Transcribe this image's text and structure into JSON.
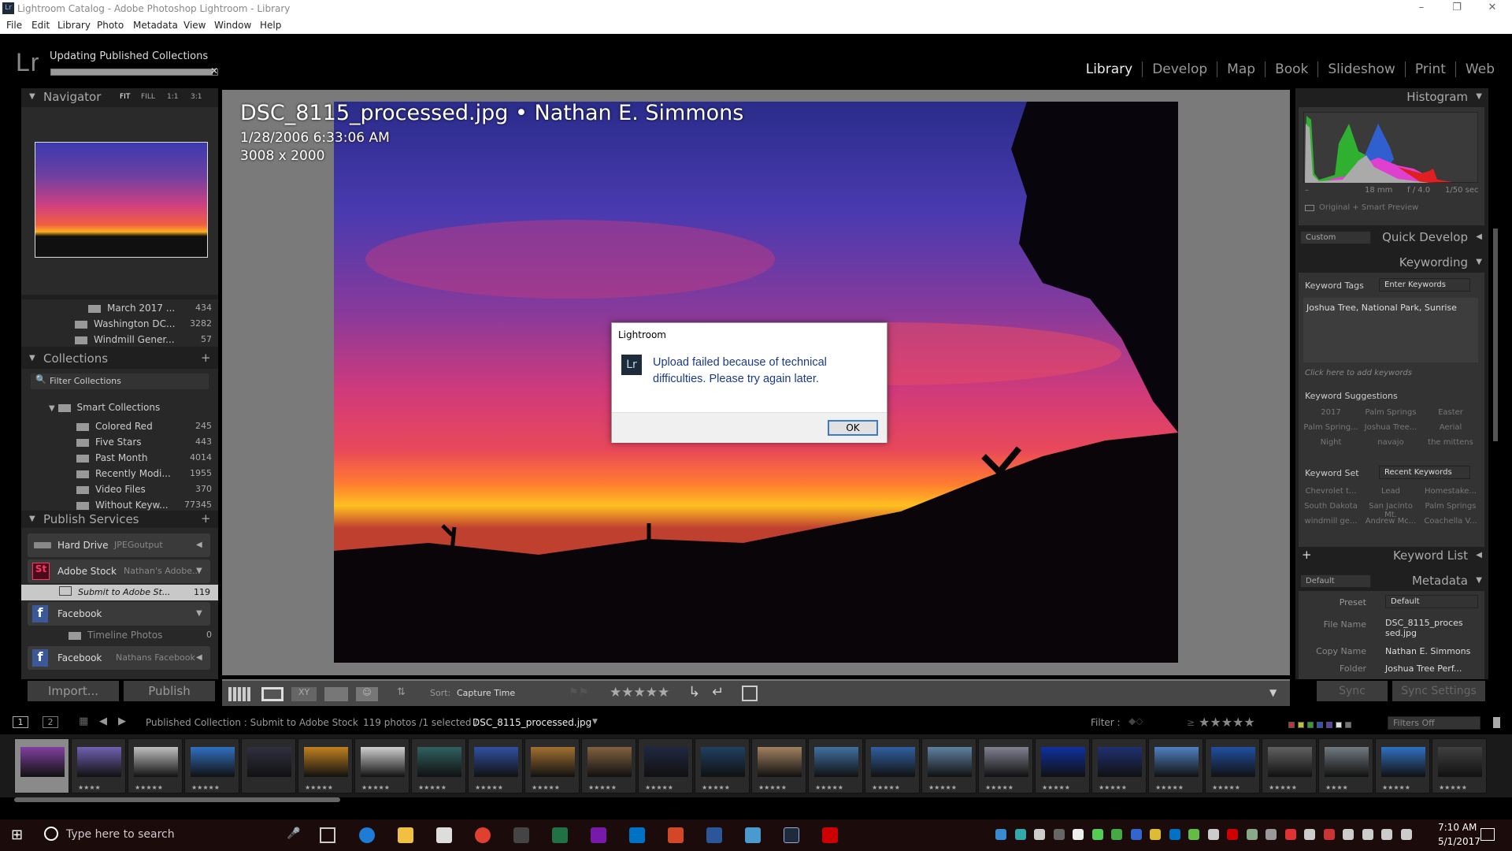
{
  "window": {
    "title": "Lightroom Catalog - Adobe Photoshop Lightroom - Library",
    "minimize": "–",
    "restore": "❐",
    "close": "✕",
    "icon": "Lr"
  },
  "menu": [
    "File",
    "Edit",
    "Library",
    "Photo",
    "Metadata",
    "View",
    "Window",
    "Help"
  ],
  "header": {
    "logo": "Lr",
    "status": "Updating Published Collections",
    "progress": 0.97,
    "cancel": "✕",
    "modules": [
      "Library",
      "Develop",
      "Map",
      "Book",
      "Slideshow",
      "Print",
      "Web"
    ]
  },
  "navigator": {
    "title": "Navigator",
    "zoom_options": [
      "FIT",
      "FILL",
      "1:1",
      "3:1"
    ]
  },
  "folders": [
    {
      "name": "March 2017 ...",
      "count": "434"
    },
    {
      "name": "Washington DC...",
      "count": "3282"
    },
    {
      "name": "Windmill Gener...",
      "count": "57"
    }
  ],
  "collections": {
    "title": "Collections",
    "add": "+",
    "filter": "Filter Collections",
    "smart_label": "Smart Collections",
    "items": [
      {
        "name": "Colored Red",
        "count": "245"
      },
      {
        "name": "Five Stars",
        "count": "443"
      },
      {
        "name": "Past Month",
        "count": "4014"
      },
      {
        "name": "Recently Modi...",
        "count": "1955"
      },
      {
        "name": "Video Files",
        "count": "370"
      },
      {
        "name": "Without Keyw...",
        "count": "77345"
      }
    ]
  },
  "publish": {
    "title": "Publish Services",
    "add": "+",
    "hard_drive": {
      "name": "Hard Drive",
      "sub": "JPEGoutput"
    },
    "adobe_stock": {
      "name": "Adobe Stock",
      "sub": "Nathan's Adobe...",
      "icon": "St"
    },
    "submit": {
      "name": "Submit to Adobe St...",
      "count": "119"
    },
    "facebook1": {
      "name": "Facebook",
      "icon": "f"
    },
    "timeline": {
      "name": "Timeline Photos",
      "count": "0"
    },
    "facebook2": {
      "name": "Facebook",
      "sub": "Nathans Facebook",
      "icon": "f"
    }
  },
  "buttons": {
    "import": "Import...",
    "publish": "Publish"
  },
  "photo": {
    "filename": "DSC_8115_processed.jpg",
    "sep": "•",
    "author": "Nathan E. Simmons",
    "date": "1/28/2006 6:33:06 AM",
    "dims": "3008 x 2000"
  },
  "toolbar": {
    "sort_label": "Sort:",
    "sort_value": "Capture Time",
    "stars": "★★★★★"
  },
  "dialog": {
    "title": "Lightroom",
    "icon": "Lr",
    "message": "Upload failed because of technical difficulties. Please try again later.",
    "ok": "OK"
  },
  "histogram": {
    "title": "Histogram",
    "focal": "18 mm",
    "aperture": "f / 4.0",
    "shutter": "1/50 sec",
    "iso": "–",
    "preview": "Original + Smart Preview"
  },
  "quick_develop": {
    "title": "Quick Develop",
    "preset": "Custom"
  },
  "keywording": {
    "title": "Keywording",
    "tags_label": "Keyword Tags",
    "tags_mode": "Enter Keywords",
    "keywords": "Joshua Tree, National Park, Sunrise",
    "add_hint": "Click here to add keywords",
    "suggestions_label": "Keyword Suggestions",
    "suggestions": [
      "2017",
      "Palm Springs",
      "Easter",
      "Palm Spring...",
      "Joshua Tree...",
      "Aerial",
      "Night",
      "navajo",
      "the mittens"
    ],
    "set_label": "Keyword Set",
    "set_value": "Recent Keywords",
    "set": [
      "Chevrolet t...",
      "Lead",
      "Homestake...",
      "South Dakota",
      "San Jacinto Mt.",
      "Palm Springs",
      "windmill ge...",
      "Andrew Mc...",
      "Coachella V..."
    ]
  },
  "keyword_list": {
    "title": "Keyword List",
    "add": "+"
  },
  "metadata": {
    "title": "Metadata",
    "preset_select": "Default",
    "preset_label": "Preset",
    "preset_value": "Default",
    "file_name_label": "File Name",
    "file_name": "DSC_8115_processed.jpg",
    "copy_name_label": "Copy Name",
    "copy_name": "Nathan E. Simmons",
    "folder_label": "Folder",
    "folder": "Joshua Tree Perf..."
  },
  "sync": {
    "sync": "Sync",
    "sync_settings": "Sync Settings"
  },
  "filmstrip": {
    "screen1": "1",
    "screen2": "2",
    "source": "Published Collection : Submit to Adobe Stock",
    "count": "119 photos /1 selected /",
    "selected": "DSC_8115_processed.jpg",
    "filter_label": "Filter :",
    "filter_ge": "≥",
    "filter_stars": "★★★★★",
    "filter_value": "Filters Off",
    "label_colors": [
      "#c0303a",
      "#c0c030",
      "#30a030",
      "#3050c0",
      "#6040b0",
      "#dddddd",
      "#777777"
    ],
    "thumbs": [
      {
        "c": "#8040a0",
        "r": 0
      },
      {
        "c": "#7060b0",
        "r": 4
      },
      {
        "c": "#c0c0c0",
        "r": 5
      },
      {
        "c": "#3070c0",
        "r": 5
      },
      {
        "c": "#303040",
        "r": 0
      },
      {
        "c": "#c08020",
        "r": 5
      },
      {
        "c": "#d0d0d0",
        "r": 5
      },
      {
        "c": "#306060",
        "r": 5
      },
      {
        "c": "#3050a0",
        "r": 5
      },
      {
        "c": "#a07030",
        "r": 5
      },
      {
        "c": "#806040",
        "r": 5
      },
      {
        "c": "#202840",
        "r": 5
      },
      {
        "c": "#204060",
        "r": 5
      },
      {
        "c": "#a08060",
        "r": 5
      },
      {
        "c": "#4070a0",
        "r": 5
      },
      {
        "c": "#3060a0",
        "r": 5
      },
      {
        "c": "#6080a0",
        "r": 5
      },
      {
        "c": "#808090",
        "r": 5
      },
      {
        "c": "#1030a0",
        "r": 5
      },
      {
        "c": "#203070",
        "r": 5
      },
      {
        "c": "#5080c0",
        "r": 5
      },
      {
        "c": "#2050a0",
        "r": 5
      },
      {
        "c": "#606060",
        "r": 5
      },
      {
        "c": "#707880",
        "r": 4
      },
      {
        "c": "#3070c0",
        "r": 5
      },
      {
        "c": "#404040",
        "r": 5
      }
    ]
  },
  "taskbar": {
    "search_placeholder": "Type here to search",
    "time": "7:10 AM",
    "date": "5/1/2017"
  }
}
